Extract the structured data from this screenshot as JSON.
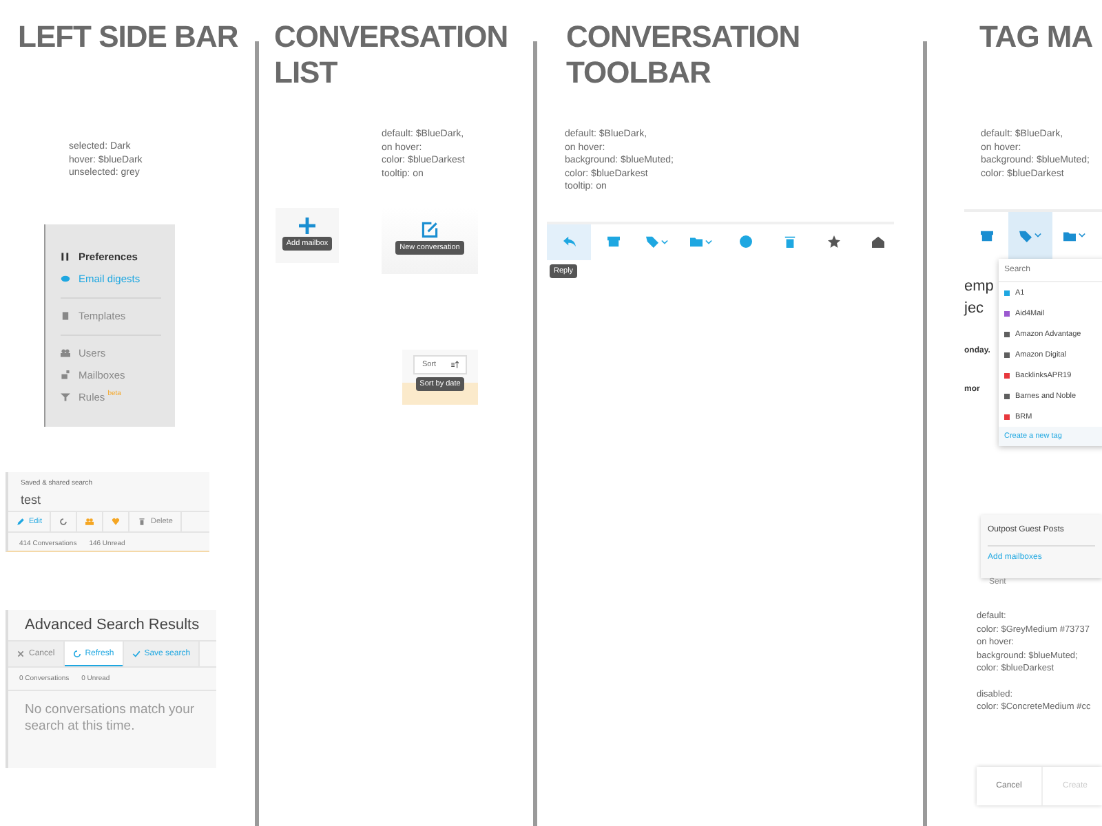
{
  "left_side_bar": {
    "title": "LEFT SIDE BAR",
    "notes": [
      "selected: Dark",
      "hover: $blueDark",
      "unselected: grey"
    ],
    "menu_groups": [
      [
        {
          "label": "Preferences",
          "selected": true,
          "hovered": false
        },
        {
          "label": "Email digests",
          "selected": false,
          "hovered": true
        }
      ],
      [
        {
          "label": "Templates",
          "selected": false,
          "hovered": false
        }
      ],
      [
        {
          "label": "Users",
          "selected": false,
          "hovered": false
        },
        {
          "label": "Mailboxes",
          "selected": false,
          "hovered": false
        },
        {
          "label": "Rules",
          "selected": false,
          "hovered": false,
          "badge": "beta"
        }
      ]
    ],
    "saved_search": {
      "label": "Saved & shared search",
      "name": "test",
      "actions": [
        "Edit",
        "Delete"
      ],
      "counts": [
        "414 Conversations",
        "146 Unread"
      ]
    },
    "advanced_search": {
      "title": "Advanced Search Results",
      "actions": [
        {
          "label": "Cancel",
          "selected": false
        },
        {
          "label": "Refresh",
          "selected": true
        },
        {
          "label": "Save search",
          "selected": false
        }
      ],
      "counts": [
        "0 Conversations",
        "0 Unread"
      ],
      "empty_message": "No conversations match your search at this time."
    }
  },
  "conversation_list": {
    "title": "CONVERSATION LIST",
    "notes": [
      "default: $BlueDark,",
      "on hover:",
      "color:  $blueDarkest",
      "tooltip: on"
    ],
    "add_mailbox_tooltip": "Add mailbox",
    "new_conversation_tooltip": "New conversation",
    "sort": {
      "label": "Sort",
      "tooltip": "Sort by date"
    }
  },
  "conversation_toolbar": {
    "title": "CONVERSATION TOOLBAR",
    "notes": [
      "default: $BlueDark,",
      "on hover:",
      "background:  $blueMuted;",
      "color:  $blueDarkest",
      "tooltip: on"
    ],
    "tools": [
      {
        "selected": true,
        "dropdown": false,
        "tooltip": "Reply"
      },
      {
        "selected": false,
        "dropdown": false
      },
      {
        "selected": false,
        "dropdown": true
      },
      {
        "selected": false,
        "dropdown": true
      },
      {
        "selected": false,
        "dropdown": false
      },
      {
        "selected": false,
        "dropdown": false
      },
      {
        "selected": false,
        "dropdown": false
      },
      {
        "selected": false,
        "dropdown": false
      }
    ]
  },
  "tag_manager": {
    "title": "TAG MA",
    "notes": [
      "default: $BlueDark,",
      "on hover:",
      "background:  $blueMuted;",
      "color:  $blueDarkest"
    ],
    "tools": [
      {
        "selected": false,
        "dropdown": false
      },
      {
        "selected": true,
        "dropdown": true
      },
      {
        "selected": false,
        "dropdown": true
      }
    ],
    "background_fragments": [
      "emp",
      "jec",
      "onday.",
      "mor"
    ],
    "search": {
      "placeholder": "Search"
    },
    "tags": [
      {
        "name": "A1",
        "color": "#1ea7e1"
      },
      {
        "name": "Aid4Mail",
        "color": "#9b59d0"
      },
      {
        "name": "Amazon Advantage",
        "color": "#5f5f5f"
      },
      {
        "name": "Amazon Digital",
        "color": "#5f5f5f"
      },
      {
        "name": "BacklinksAPR19",
        "color": "#e8383d"
      },
      {
        "name": "Barnes and Noble",
        "color": "#5f5f5f"
      },
      {
        "name": "BRM",
        "color": "#e8383d"
      }
    ],
    "create_link": "Create a new tag",
    "mailboxes": [
      "Outpost Guest Posts"
    ],
    "add_mailboxes": "Add mailboxes",
    "sent": "Sent",
    "button_notes": [
      [
        "default:",
        "color: $GreyMedium #73737",
        "on hover:",
        "background:  $blueMuted;",
        "color:  $blueDarkest"
      ],
      [
        "disabled:",
        "color: $ConcreteMedium #cc"
      ]
    ],
    "buttons": [
      {
        "label": "Cancel",
        "disabled": false
      },
      {
        "label": "Create",
        "disabled": true
      }
    ]
  }
}
